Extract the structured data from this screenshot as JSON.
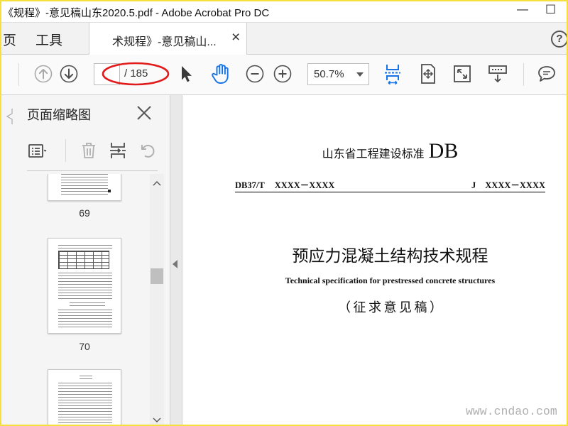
{
  "window": {
    "title": "《规程》-意见稿山东2020.5.pdf - Adobe Acrobat Pro DC",
    "controls": {
      "minimize": "—",
      "maximize": "☐"
    }
  },
  "nav_tabs": {
    "home": "页",
    "tools": "工具",
    "document_tab": "术规程》-意见稿山...",
    "document_tab_close": "×",
    "help": "?"
  },
  "toolbar": {
    "page_total": "/ 185",
    "zoom_value": "50.7%",
    "icons": [
      "previous-page-icon",
      "next-page-icon",
      "select-tool-icon",
      "hand-tool-icon",
      "zoom-out-icon",
      "zoom-in-icon",
      "scroll-mode-icon",
      "fit-page-icon",
      "full-screen-icon",
      "read-mode-icon",
      "comment-icon"
    ]
  },
  "thumbnails_panel": {
    "title": "页面缩略图",
    "icons": [
      "panel-pointer-icon",
      "close-icon",
      "thumbnail-options-icon",
      "trash-icon",
      "insert-pages-icon",
      "rotate-icon"
    ],
    "pages": [
      {
        "label": "69"
      },
      {
        "label": "70"
      }
    ]
  },
  "document": {
    "standard_label": "山东省工程建设标准",
    "standard_code": "DB",
    "code_left_prefix": "DB37/T",
    "code_left_number": "XXXX－XXXX",
    "code_right_prefix": "J",
    "code_right_number": "XXXX－XXXX",
    "title": "预应力混凝土结构技术规程",
    "title_en": "Technical specification for prestressed concrete structures",
    "draft_note": "（征求意见稿）"
  },
  "watermark": "www.cndao.com",
  "colors": {
    "accent": "#1473e6",
    "annotation": "#e11b1b",
    "frame": "#f5df3c",
    "watermark": "#b0b0b0"
  }
}
